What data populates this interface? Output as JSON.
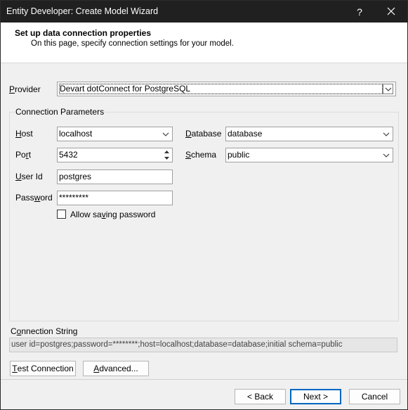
{
  "window": {
    "title": "Entity Developer: Create Model Wizard",
    "help_glyph": "?",
    "close_glyph": "✕"
  },
  "header": {
    "title": "Set up data connection properties",
    "subtitle": "On this page, specify connection settings for your model."
  },
  "provider": {
    "label_accel": "P",
    "label_rest": "rovider",
    "value": "Devart dotConnect for PostgreSQL"
  },
  "connection_parameters": {
    "group_title": "Connection Parameters",
    "host": {
      "label_accel": "H",
      "label_rest": "ost",
      "value": "localhost"
    },
    "port": {
      "label_pre": "Po",
      "label_accel": "r",
      "label_rest": "t",
      "value": "5432"
    },
    "user_id": {
      "label_accel": "U",
      "label_rest": "ser Id",
      "value": "postgres"
    },
    "password": {
      "label_pre": "Pass",
      "label_accel": "w",
      "label_rest": "ord",
      "value": "*********"
    },
    "allow_saving": {
      "label_pre": "Allow sa",
      "label_accel": "v",
      "label_rest": "ing password",
      "checked": false
    },
    "database": {
      "label_accel": "D",
      "label_rest": "atabase",
      "value": "database"
    },
    "schema": {
      "label_accel": "S",
      "label_rest": "chema",
      "value": "public"
    }
  },
  "connection_string": {
    "label_pre": "C",
    "label_accel": "o",
    "label_rest": "nnection String",
    "value": "user id=postgres;password=********;host=localhost;database=database;initial schema=public"
  },
  "buttons": {
    "test_connection": {
      "label_accel": "T",
      "label_rest": "est Connection"
    },
    "advanced": {
      "label_accel": "A",
      "label_rest": "dvanced..."
    },
    "back": "< Back",
    "next": "Next >",
    "cancel": "Cancel"
  },
  "colors": {
    "titlebar": "#202020",
    "accent": "#0067c0",
    "dialog_bg": "#f0f0f0"
  }
}
